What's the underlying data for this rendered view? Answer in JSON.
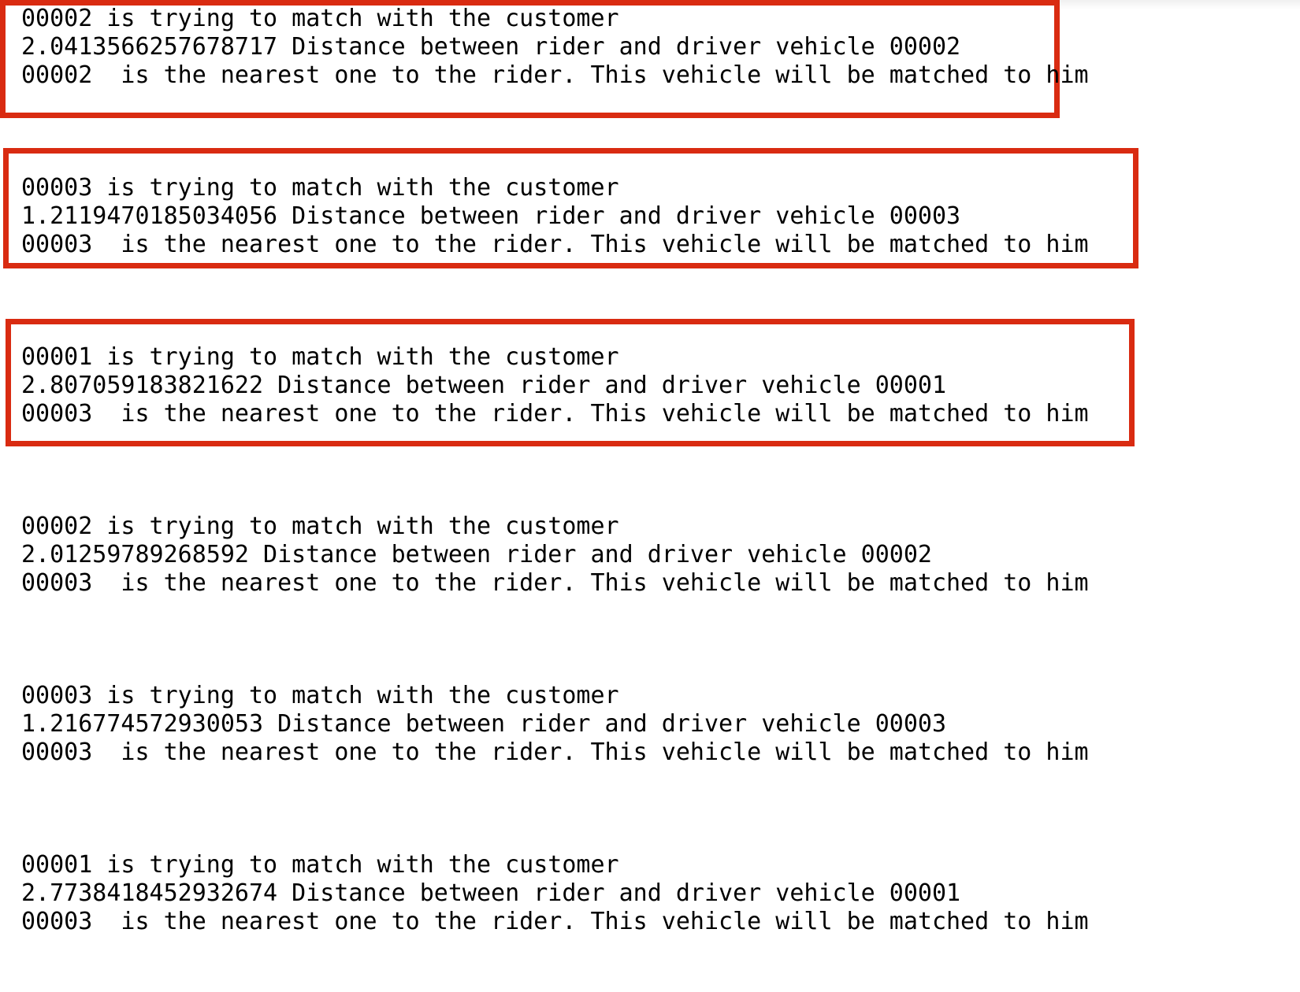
{
  "blocks": [
    {
      "highlighted": true,
      "lines": [
        "00002 is trying to match with the customer",
        "2.0413566257678717 Distance between rider and driver vehicle 00002",
        "00002  is the nearest one to the rider. This vehicle will be matched to him"
      ]
    },
    {
      "highlighted": true,
      "lines": [
        "00003 is trying to match with the customer",
        "1.2119470185034056 Distance between rider and driver vehicle 00003",
        "00003  is the nearest one to the rider. This vehicle will be matched to him"
      ]
    },
    {
      "highlighted": true,
      "lines": [
        "00001 is trying to match with the customer",
        "2.807059183821622 Distance between rider and driver vehicle 00001",
        "00003  is the nearest one to the rider. This vehicle will be matched to him"
      ]
    },
    {
      "highlighted": false,
      "lines": [
        "00002 is trying to match with the customer",
        "2.01259789268592 Distance between rider and driver vehicle 00002",
        "00003  is the nearest one to the rider. This vehicle will be matched to him"
      ]
    },
    {
      "highlighted": false,
      "lines": [
        "00003 is trying to match with the customer",
        "1.216774572930053 Distance between rider and driver vehicle 00003",
        "00003  is the nearest one to the rider. This vehicle will be matched to him"
      ]
    },
    {
      "highlighted": false,
      "lines": [
        "00001 is trying to match with the customer",
        "2.7738418452932674 Distance between rider and driver vehicle 00001",
        "00003  is the nearest one to the rider. This vehicle will be matched to him"
      ]
    }
  ],
  "colors": {
    "highlight_border": "#d92b11",
    "text": "#000000",
    "background": "#ffffff"
  }
}
